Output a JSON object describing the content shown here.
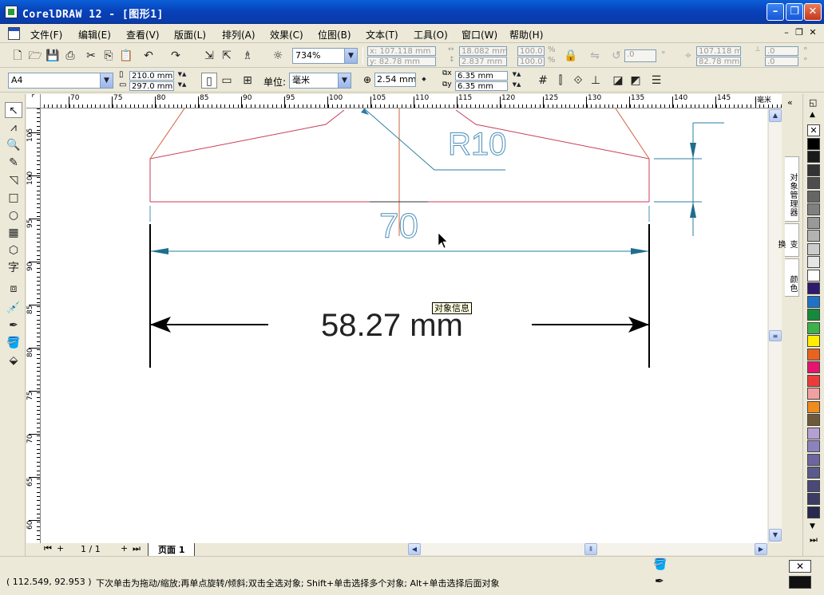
{
  "window": {
    "title": "CorelDRAW 12 - [图形1]"
  },
  "menu": {
    "items": [
      "文件(F)",
      "编辑(E)",
      "查看(V)",
      "版面(L)",
      "排列(A)",
      "效果(C)",
      "位图(B)",
      "文本(T)",
      "工具(O)",
      "窗口(W)",
      "帮助(H)"
    ]
  },
  "toolbar_standard": {
    "zoom": "734%",
    "x": "x: 107.118 mm",
    "y": "y: 82.78 mm",
    "w": "18.082 mm",
    "h": "2.837 mm",
    "scale_x": "100.0",
    "scale_y": "100.0",
    "pct": "%",
    "rotation": ".0",
    "deg": "°",
    "cx": "107.118 mm",
    "cy": "82.78 mm",
    "skew_x": ".0",
    "skew_y": ".0"
  },
  "property_bar": {
    "paper": "A4",
    "page_width": "210.0 mm",
    "page_height": "297.0 mm",
    "units_label": "单位:",
    "units": "毫米",
    "nudge": "2.54 mm",
    "dup_x": "6.35 mm",
    "dup_y": "6.35 mm"
  },
  "ruler": {
    "h_marks": [
      "5",
      "70",
      "75",
      "80",
      "85",
      "90",
      "95",
      "100",
      "105",
      "110",
      "115",
      "120",
      "125",
      "130",
      "135",
      "140",
      "145",
      "毫米"
    ],
    "v_marks": [
      "105",
      "100",
      "95",
      "90",
      "85",
      "80",
      "75",
      "70",
      "65",
      "60"
    ]
  },
  "drawing": {
    "radius_label": "R10",
    "dim_70": "70",
    "dim_measure": "58.27 mm",
    "tooltip": "对象信息"
  },
  "pager": {
    "count": "1 / 1",
    "page_tab": "页面 1"
  },
  "dockers": {
    "tabs": [
      "对象管理器",
      "变换",
      "颜色"
    ]
  },
  "palette": {
    "colors": [
      "#ffffff",
      "#000000",
      "#1a1a1a",
      "#333333",
      "#4d4d4d",
      "#666666",
      "#808080",
      "#999999",
      "#b3b3b3",
      "#cccccc",
      "#e6e6e6",
      "#ffffff",
      "#2e1a6e",
      "#1e73c8",
      "#158a3c",
      "#3cb34a",
      "#ffee00",
      "#e8641e",
      "#e6146e",
      "#ee3a3a",
      "#f0a0a0",
      "#f08c1e",
      "#6e5a3a",
      "#b4a0d2",
      "#8c82be",
      "#6e64a0",
      "#5a5a8c",
      "#4a4a78",
      "#3c3c64",
      "#282850"
    ]
  },
  "status": {
    "coords": "( 112.549, 92.953 )",
    "message": "下次单击为拖动/缩放;再单点旋转/倾斜;双击全选对象; Shift+单击选择多个对象; Alt+单击选择后面对象"
  }
}
